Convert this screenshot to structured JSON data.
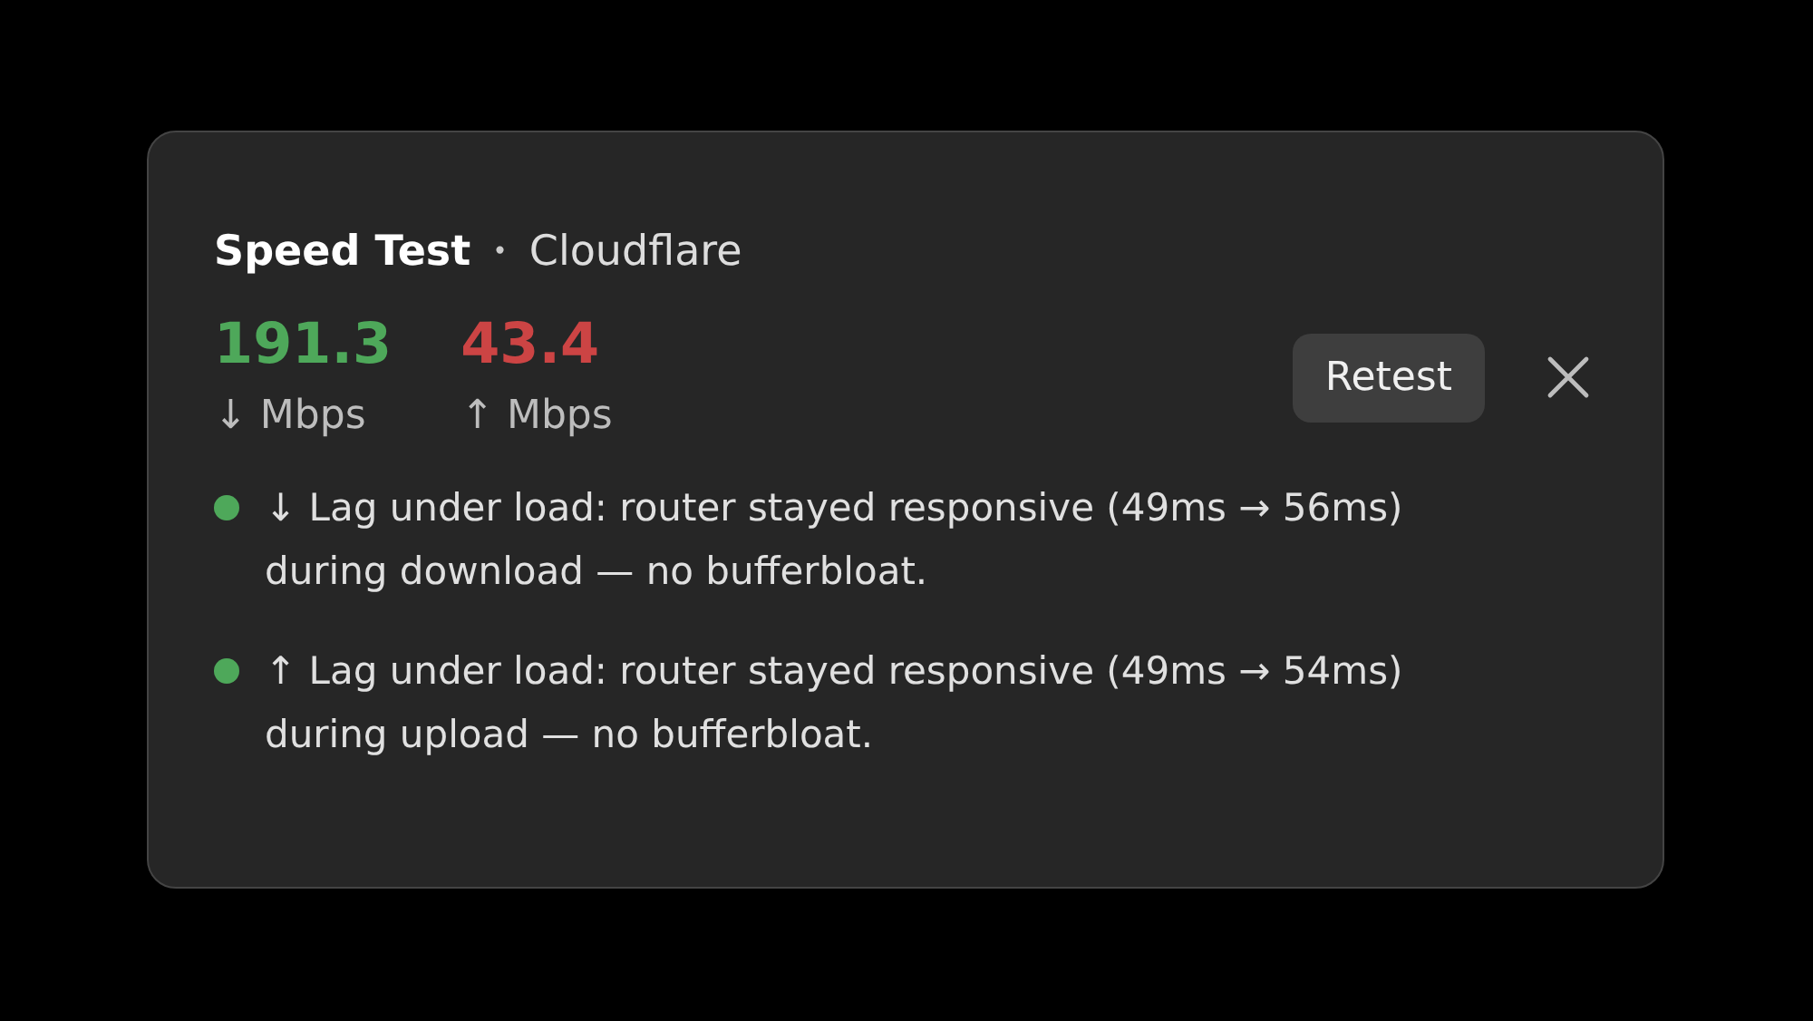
{
  "header": {
    "title": "Speed Test",
    "separator": "•",
    "provider": "Cloudflare"
  },
  "results": [
    {
      "value": "191.3",
      "unit": "↓ Mbps",
      "color": "#4ea85a"
    },
    {
      "value": "43.4",
      "unit": "↑ Mbps",
      "color": "#cc4444"
    }
  ],
  "actions": {
    "retest": "Retest"
  },
  "notes": [
    {
      "text": "↓ Lag under load: router stayed responsive (49ms → 56ms) during download — no bufferbloat.",
      "color": "#4ea85a"
    },
    {
      "text": "↑ Lag under load: router stayed responsive (49ms → 54ms) during upload — no bufferbloat.",
      "color": "#4ea85a"
    }
  ]
}
